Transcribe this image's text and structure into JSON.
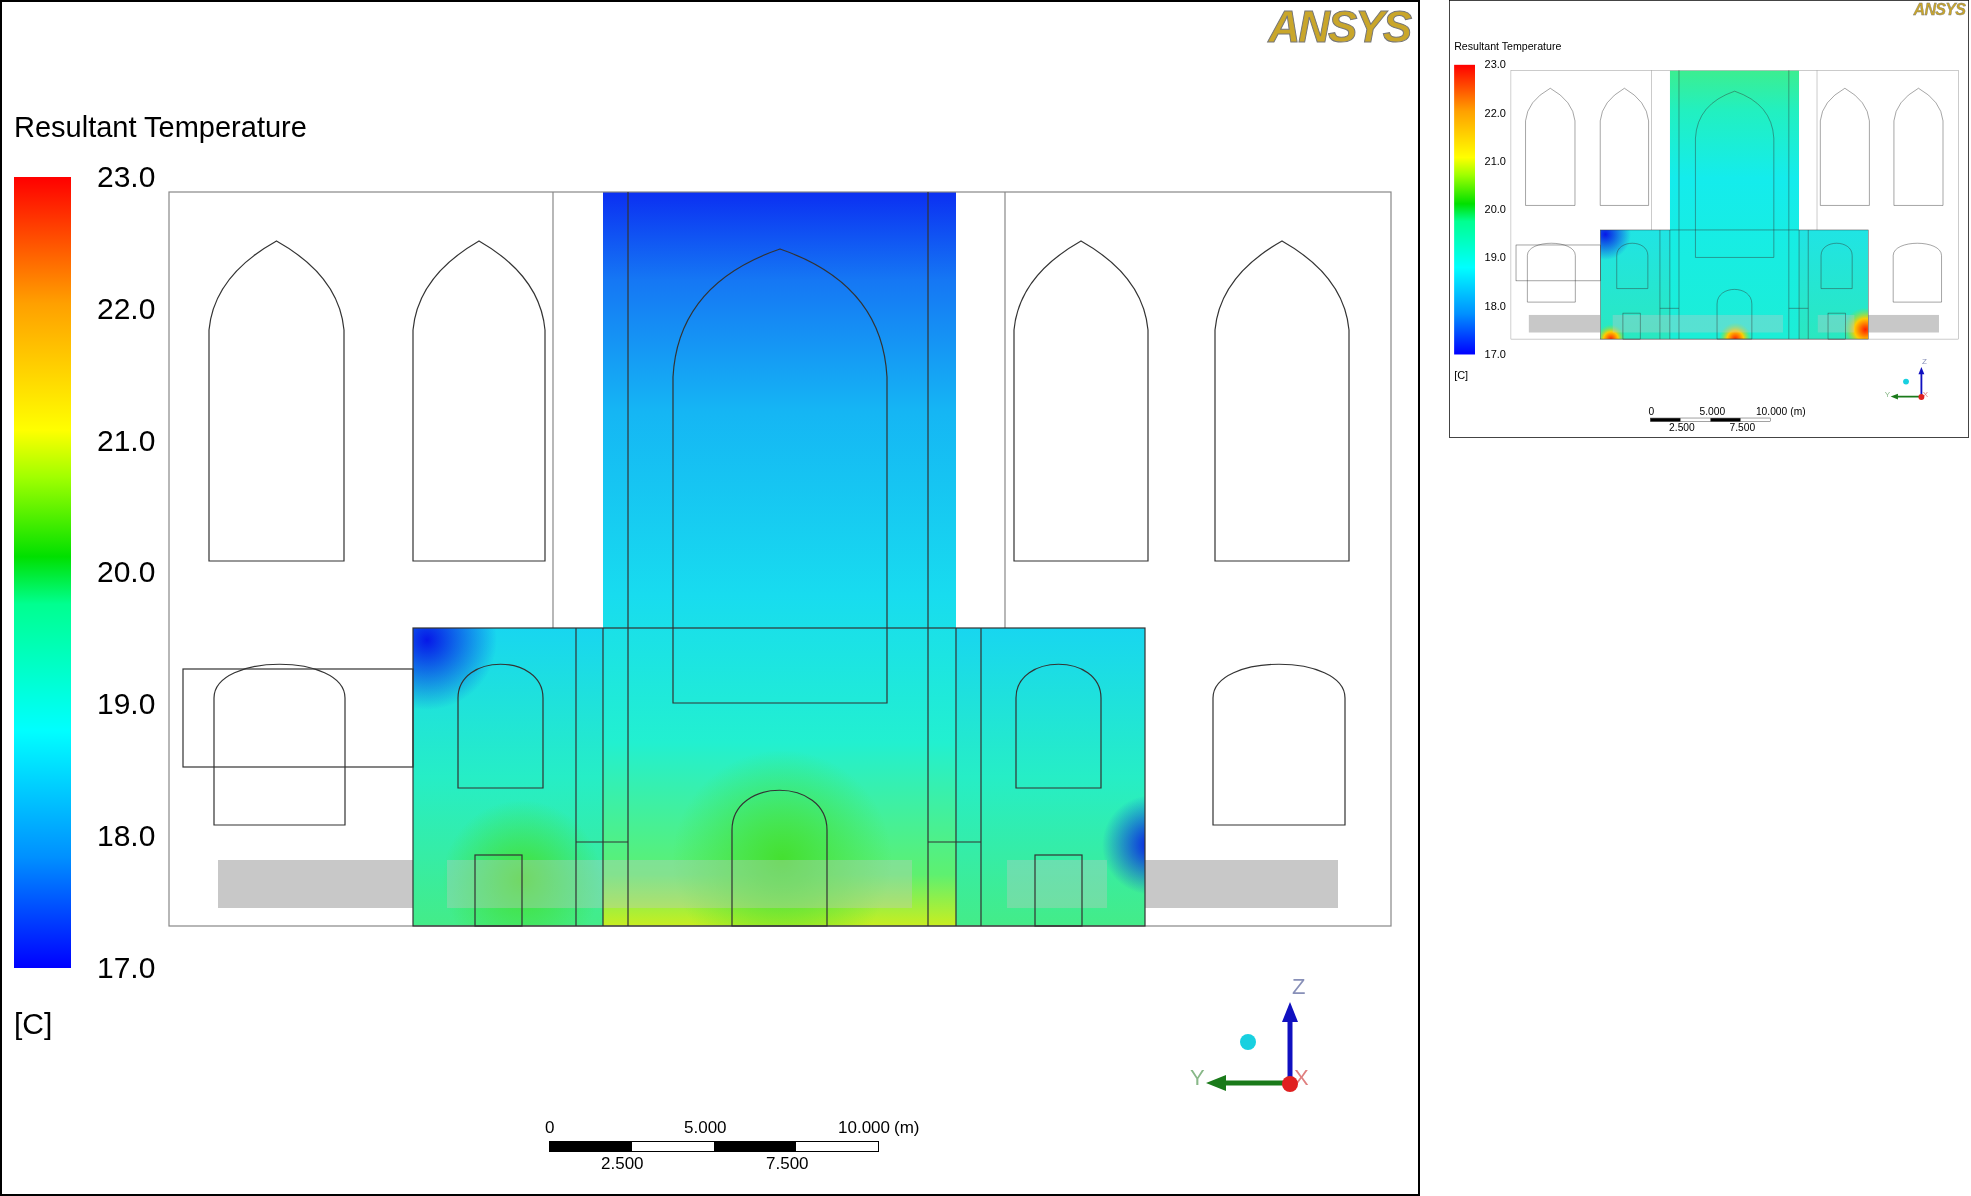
{
  "viewports": [
    {
      "logo": "ANSYS",
      "legend": {
        "title": "Resultant Temperature",
        "ticks": [
          "23.0",
          "22.0",
          "21.0",
          "20.0",
          "19.0",
          "18.0",
          "17.0"
        ],
        "unit": "[C]"
      },
      "scale_bar": {
        "top_labels": [
          "0",
          "5.000",
          "10.000"
        ],
        "unit": "(m)",
        "bottom_labels": [
          "2.500",
          "7.500"
        ]
      },
      "triad": {
        "z": "Z",
        "y": "Y",
        "x": "X"
      }
    },
    {
      "logo": "ANSYS",
      "legend": {
        "title": "Resultant Temperature",
        "ticks": [
          "23.0",
          "22.0",
          "21.0",
          "20.0",
          "19.0",
          "18.0",
          "17.0"
        ],
        "unit": "[C]"
      },
      "scale_bar": {
        "top_labels": [
          "0",
          "5.000",
          "10.000"
        ],
        "unit": "(m)",
        "bottom_labels": [
          "2.500",
          "7.500"
        ]
      },
      "triad": {
        "z": "Z",
        "y": "Y",
        "x": "X"
      }
    }
  ]
}
